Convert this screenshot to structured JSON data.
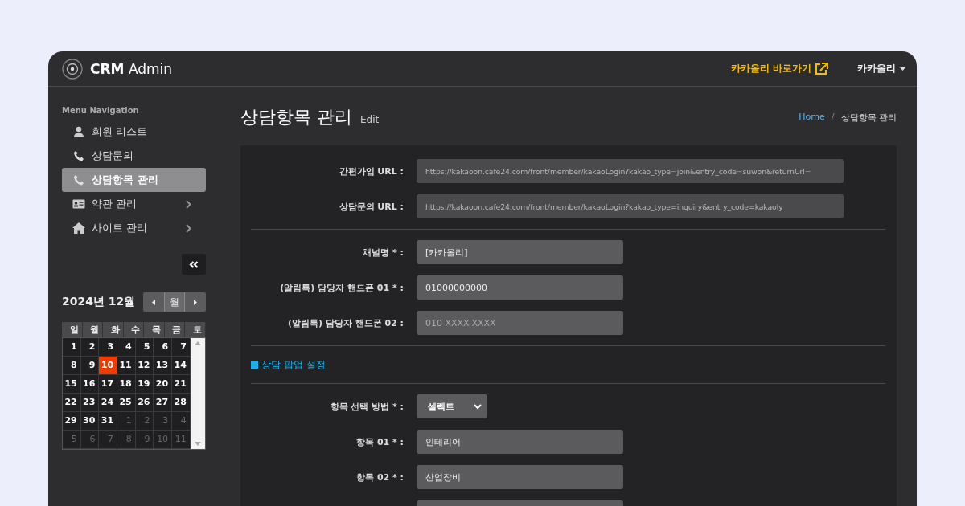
{
  "header": {
    "brand_bold": "CRM",
    "brand_light": "Admin",
    "shortcut_link": "카카올리 바로가기",
    "user_menu": "카카올리"
  },
  "sidebar": {
    "heading": "Menu Navigation",
    "items": [
      {
        "label": "회원 리스트",
        "kind": "person",
        "selected": false,
        "has_submenu": false
      },
      {
        "label": "상담문의",
        "kind": "phone",
        "selected": false,
        "has_submenu": false
      },
      {
        "label": "상담항목 관리",
        "kind": "phone",
        "selected": true,
        "has_submenu": false
      },
      {
        "label": "약관 관리",
        "kind": "card",
        "selected": false,
        "has_submenu": true
      },
      {
        "label": "사이트 관리",
        "kind": "home",
        "selected": false,
        "has_submenu": true
      }
    ]
  },
  "calendar": {
    "title": "2024년 12월",
    "view_button": "월",
    "weekdays": [
      "일",
      "월",
      "화",
      "수",
      "목",
      "금",
      "토"
    ],
    "weeks": [
      [
        {
          "day": "1",
          "muted": false,
          "selected": false
        },
        {
          "day": "2",
          "muted": false,
          "selected": false
        },
        {
          "day": "3",
          "muted": false,
          "selected": false
        },
        {
          "day": "4",
          "muted": false,
          "selected": false
        },
        {
          "day": "5",
          "muted": false,
          "selected": false
        },
        {
          "day": "6",
          "muted": false,
          "selected": false
        },
        {
          "day": "7",
          "muted": false,
          "selected": false
        }
      ],
      [
        {
          "day": "8",
          "muted": false,
          "selected": false
        },
        {
          "day": "9",
          "muted": false,
          "selected": false
        },
        {
          "day": "10",
          "muted": false,
          "selected": true
        },
        {
          "day": "11",
          "muted": false,
          "selected": false
        },
        {
          "day": "12",
          "muted": false,
          "selected": false
        },
        {
          "day": "13",
          "muted": false,
          "selected": false
        },
        {
          "day": "14",
          "muted": false,
          "selected": false
        }
      ],
      [
        {
          "day": "15",
          "muted": false,
          "selected": false
        },
        {
          "day": "16",
          "muted": false,
          "selected": false
        },
        {
          "day": "17",
          "muted": false,
          "selected": false
        },
        {
          "day": "18",
          "muted": false,
          "selected": false
        },
        {
          "day": "19",
          "muted": false,
          "selected": false
        },
        {
          "day": "20",
          "muted": false,
          "selected": false
        },
        {
          "day": "21",
          "muted": false,
          "selected": false
        }
      ],
      [
        {
          "day": "22",
          "muted": false,
          "selected": false
        },
        {
          "day": "23",
          "muted": false,
          "selected": false
        },
        {
          "day": "24",
          "muted": false,
          "selected": false
        },
        {
          "day": "25",
          "muted": false,
          "selected": false
        },
        {
          "day": "26",
          "muted": false,
          "selected": false
        },
        {
          "day": "27",
          "muted": false,
          "selected": false
        },
        {
          "day": "28",
          "muted": false,
          "selected": false
        }
      ],
      [
        {
          "day": "29",
          "muted": false,
          "selected": false
        },
        {
          "day": "30",
          "muted": false,
          "selected": false
        },
        {
          "day": "31",
          "muted": false,
          "selected": false
        },
        {
          "day": "1",
          "muted": true,
          "selected": false
        },
        {
          "day": "2",
          "muted": true,
          "selected": false
        },
        {
          "day": "3",
          "muted": true,
          "selected": false
        },
        {
          "day": "4",
          "muted": true,
          "selected": false
        }
      ],
      [
        {
          "day": "5",
          "muted": true,
          "selected": false
        },
        {
          "day": "6",
          "muted": true,
          "selected": false
        },
        {
          "day": "7",
          "muted": true,
          "selected": false
        },
        {
          "day": "8",
          "muted": true,
          "selected": false
        },
        {
          "day": "9",
          "muted": true,
          "selected": false
        },
        {
          "day": "10",
          "muted": true,
          "selected": false
        },
        {
          "day": "11",
          "muted": true,
          "selected": false
        }
      ]
    ]
  },
  "page": {
    "title": "상담항목 관리",
    "subtitle": "Edit",
    "breadcrumb_separator": "/",
    "breadcrumb": [
      {
        "label": "Home",
        "kind": "link"
      },
      {
        "label": "상담항목 관리",
        "kind": "current"
      }
    ]
  },
  "form": {
    "sections": [
      {
        "fields": [
          {
            "label": "간편가입 URL :",
            "kind": "text",
            "disabled": true,
            "value": "https://kakaoon.cafe24.com/front/member/kakaoLogin?kakao_type=join&entry_code=suwon&returnUrl="
          },
          {
            "label": "상담문의 URL :",
            "kind": "text",
            "disabled": true,
            "value": "https://kakaoon.cafe24.com/front/member/kakaoLogin?kakao_type=inquiry&entry_code=kakaoly"
          }
        ]
      },
      {
        "fields": [
          {
            "label": "채널명 * :",
            "kind": "short",
            "disabled": false,
            "value": "[카카올리]"
          },
          {
            "label": "(알림톡) 담당자 핸드폰 01 * :",
            "kind": "short",
            "disabled": false,
            "value": "01000000000"
          },
          {
            "label": "(알림톡) 담당자 핸드폰 02 :",
            "kind": "short",
            "disabled": false,
            "placeholder": "010-XXXX-XXXX"
          }
        ]
      },
      {
        "heading": "상담 팝업 설정",
        "fields": [
          {
            "label": "항목 선택 방법 * :",
            "kind": "select",
            "disabled": false,
            "value": "셀렉트"
          },
          {
            "label": "항목 01 * :",
            "kind": "short",
            "disabled": false,
            "value": "인테리어"
          },
          {
            "label": "항목 02 * :",
            "kind": "short",
            "disabled": false,
            "value": "산업장비"
          }
        ]
      }
    ]
  }
}
